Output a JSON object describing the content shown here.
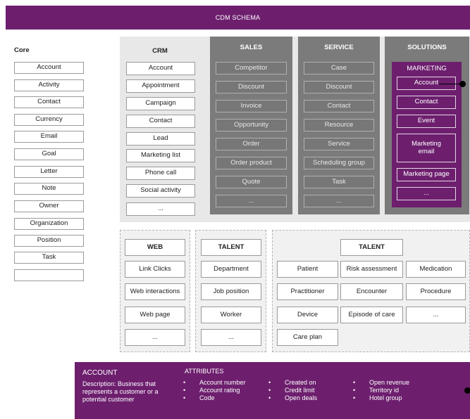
{
  "title": "CDM SCHEMA",
  "core": {
    "heading": "Core",
    "items": [
      "Account",
      "Activity",
      "Contact",
      "Currency",
      "Email",
      "Goal",
      "Letter",
      "Note",
      "Owner",
      "Organization",
      "Position",
      "Task",
      ""
    ]
  },
  "crm": {
    "heading": "CRM",
    "items": [
      "Account",
      "Appointment",
      "Campaign",
      "Contact",
      "Lead",
      "Marketing list",
      "Phone call",
      "Social activity",
      "..."
    ]
  },
  "sales": {
    "heading": "SALES",
    "items": [
      "Competitor",
      "Discount",
      "Invoice",
      "Opportunity",
      "Order",
      "Order product",
      "Quote",
      "..."
    ]
  },
  "service": {
    "heading": "SERVICE",
    "items": [
      "Case",
      "Discount",
      "Contact",
      "Resource",
      "Service",
      "Scheduling group",
      "Task",
      "..."
    ]
  },
  "solutions": {
    "heading": "SOLUTIONS",
    "marketing": {
      "heading": "MARKETING",
      "items": [
        "Account",
        "Contact",
        "Event",
        "Marketing email",
        "Marketing page",
        "..."
      ]
    }
  },
  "web": {
    "heading": "WEB",
    "items": [
      "Link Clicks",
      "Web interactions",
      "Web page",
      "..."
    ]
  },
  "talent": {
    "heading": "TALENT",
    "items": [
      "Department",
      "Job position",
      "Worker",
      "..."
    ]
  },
  "talent2": {
    "heading": "TALENT",
    "grid": [
      "Patient",
      "Risk assessment",
      "Medication",
      "Practitioner",
      "Encounter",
      "Procedure",
      "Device",
      "Episode of care",
      "...",
      "Care plan"
    ]
  },
  "footer": {
    "entity": "ACCOUNT",
    "description": "Description: Business that represents a customer or a potential customer",
    "attributes_label": "ATTRIBUTES",
    "col1": [
      "Account number",
      "Account rating",
      "Code"
    ],
    "col2": [
      "Created on",
      "Credit limit",
      "Open deals"
    ],
    "col3": [
      "Open revenue",
      "Territory id",
      "Hotel group"
    ]
  },
  "colors": {
    "accent_purple": "#6d1f6e",
    "dark_gray": "#7b7b7b",
    "light_gray": "#e8e8e8"
  }
}
